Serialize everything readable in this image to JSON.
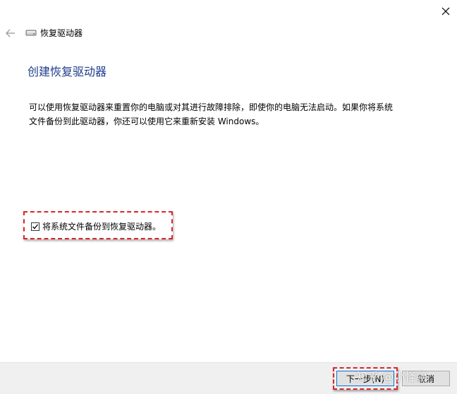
{
  "window": {
    "title": "恢复驱动器"
  },
  "main": {
    "heading": "创建恢复驱动器",
    "description": "可以使用恢复驱动器来重置你的电脑或对其进行故障排除，即使你的电脑无法启动。如果你将系统文件备份到此驱动器，你还可以使用它来重新安装 Windows。",
    "checkbox": {
      "label": "将系统文件备份到恢复驱动器。",
      "checked": true
    }
  },
  "footer": {
    "next_label": "下一步(N)",
    "cancel_label": "取消"
  },
  "watermark": "知乎 @小怪兽",
  "icons": {
    "close": "close-icon",
    "back": "back-arrow-icon",
    "drive": "drive-icon",
    "check": "checkmark-icon"
  },
  "colors": {
    "heading": "#1e3c8c",
    "highlight": "#d8262c",
    "footer_bg": "#f0f0f0"
  }
}
